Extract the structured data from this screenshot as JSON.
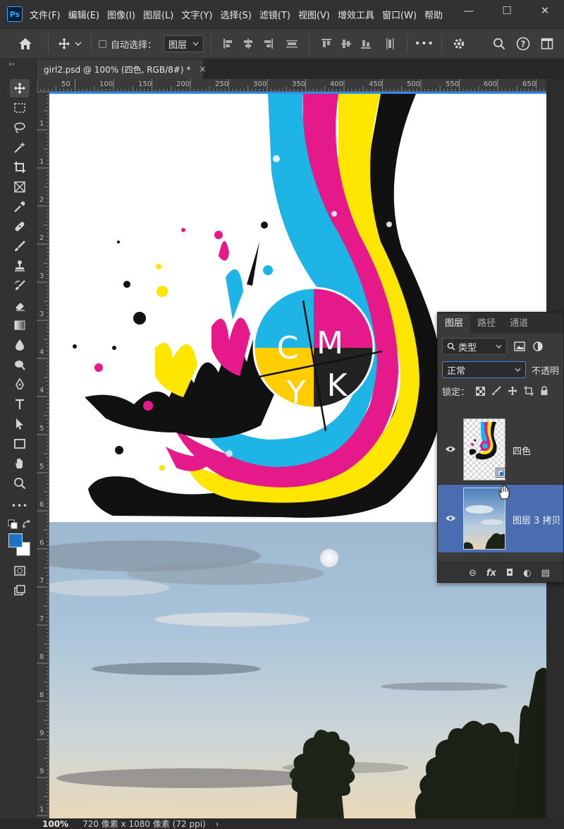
{
  "app": {
    "logo": "Ps"
  },
  "menu": [
    "文件(F)",
    "编辑(E)",
    "图像(I)",
    "图层(L)",
    "文字(Y)",
    "选择(S)",
    "滤镜(T)",
    "视图(V)",
    "增效工具",
    "窗口(W)",
    "帮助"
  ],
  "window_controls": {
    "minimize": "—",
    "restore": "☐",
    "close": "✕"
  },
  "options_bar": {
    "auto_select_label": "自动选择：",
    "auto_select_target": "图层",
    "more_icon": "•••"
  },
  "tab": {
    "title": "girl2.psd @ 100% (四色, RGB/8#) *",
    "close": "×"
  },
  "ruler": {
    "top_ticks": [
      "50",
      "100",
      "150",
      "200",
      "250",
      "300",
      "350",
      "400",
      "450",
      "500",
      "550",
      "600",
      "650"
    ],
    "left_ticks": [
      "1",
      "1",
      "2",
      "2",
      "3",
      "3",
      "4",
      "4",
      "5",
      "5",
      "6",
      "6",
      "7",
      "7",
      "8",
      "8",
      "9",
      "9",
      "1"
    ]
  },
  "artwork": {
    "letters": [
      "C",
      "M",
      "Y",
      "K"
    ],
    "colors": {
      "cyan": "#1fb4e6",
      "magenta": "#e5198a",
      "yellow": "#ffe600",
      "black": "#111111"
    }
  },
  "layers_panel": {
    "tabs": [
      "图层",
      "路径",
      "通道"
    ],
    "filter_label": "类型",
    "blend_mode": "正常",
    "opacity_label": "不透明",
    "lock_label": "锁定：",
    "layers": [
      {
        "name": "四色",
        "selected": false
      },
      {
        "name": "图层 3 拷贝",
        "selected": true
      }
    ],
    "footer": [
      "⊖",
      "fx",
      "◘",
      "◐",
      "▤"
    ]
  },
  "status_bar": {
    "zoom": "100%",
    "doc_info": "720 像素 x 1080 像素 (72 ppi)",
    "arrow": "›"
  }
}
